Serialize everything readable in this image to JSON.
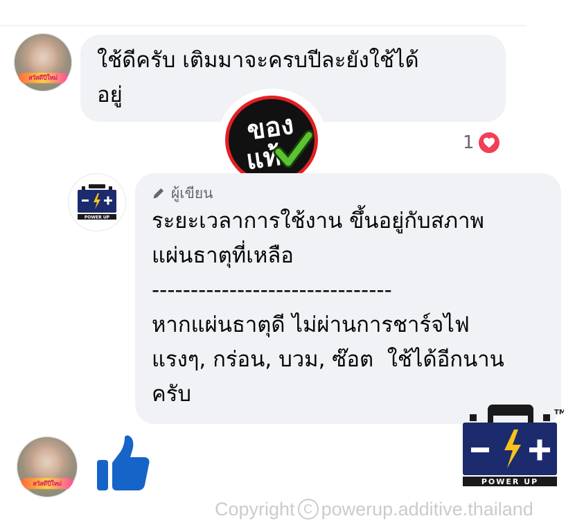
{
  "comment": {
    "text": "ใช้ดีครับ เติมมาจะครบปีละยังใช้ได้\nอยู่",
    "reaction_count": "1",
    "avatar_banner": "สวัสดีปีใหม่"
  },
  "sticker": {
    "text_top": "ของ",
    "text_bottom": "แท้"
  },
  "reply": {
    "author_tag": "ผู้เขียน",
    "text": "ระยะเวลาการใช้งาน ขึ้นอยู่กับสภาพ\nแผ่นธาตุที่เหลือ\n-------------------------------\nหากแผ่นธาตุดี ไม่ผ่านการชาร์จไฟ\nแรงๆ, กร่อน, บวม, ซ๊อต  ใช้ได้อีกนาน\nครับ"
  },
  "logo": {
    "brand_label": "POWER UP",
    "trademark": "TM"
  },
  "reaction_reply": {
    "avatar_banner": "สวัสดีปีใหม่",
    "icon": "thumbs-up-icon"
  },
  "footer": {
    "prefix": "Copyright",
    "symbol": "C",
    "handle": "powerup.additive.thailand"
  },
  "colors": {
    "bubble": "#f0f2f5",
    "like_blue": "#1877f2",
    "heart_red": "#f33e58",
    "logo_navy": "#1c2b6e",
    "logo_yellow": "#f7c21b",
    "sticker_red": "#e22024",
    "check_green": "#4caf2c"
  }
}
